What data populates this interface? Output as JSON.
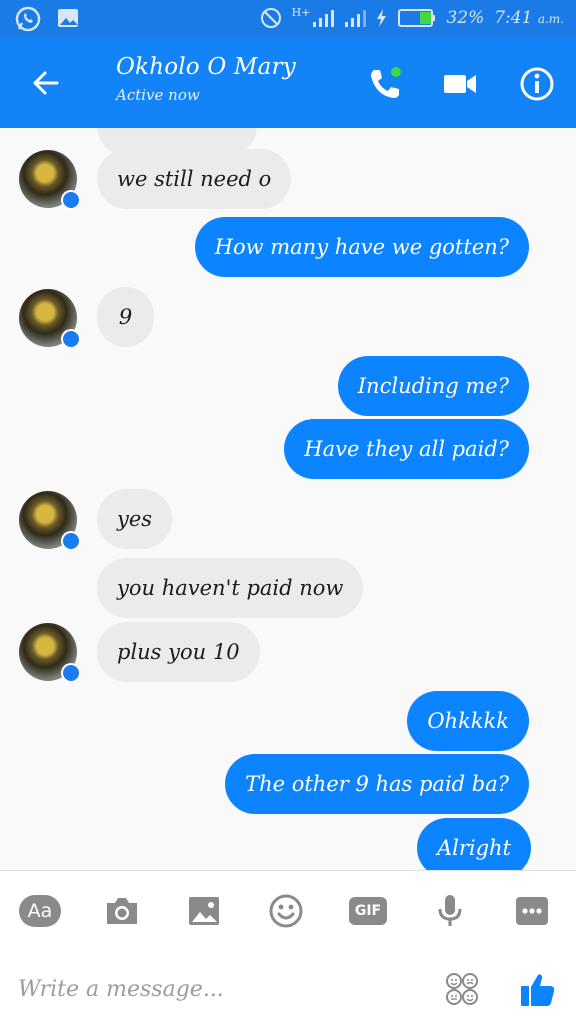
{
  "status_bar": {
    "network": "H+",
    "battery": "32%",
    "time": "7:41",
    "ampm": "a.m."
  },
  "header": {
    "contact_name": "Okholo O Mary",
    "status": "Active now"
  },
  "messages": [
    {
      "from": "them",
      "text": "we still need o"
    },
    {
      "from": "me",
      "text": "How many have we gotten?"
    },
    {
      "from": "them",
      "text": "9"
    },
    {
      "from": "me",
      "text": "Including me?"
    },
    {
      "from": "me",
      "text": "Have they all paid?"
    },
    {
      "from": "them",
      "text": "yes"
    },
    {
      "from": "them",
      "text": "you haven't paid now"
    },
    {
      "from": "them",
      "text": "plus you 10"
    },
    {
      "from": "me",
      "text": "Ohkkkk"
    },
    {
      "from": "me",
      "text": "The other 9 has paid ba?"
    },
    {
      "from": "me",
      "text": "Alright"
    }
  ],
  "composer": {
    "aa_label": "Aa",
    "gif_label": "GIF",
    "placeholder": "Write a message..."
  },
  "colors": {
    "status_bar": "#1a7ae6",
    "header": "#1284f7",
    "outgoing_bubble": "#0c84ff",
    "incoming_bubble": "#ebebeb",
    "online_dot": "#44d744",
    "icon_grey": "#8a8a8a"
  },
  "icons": {
    "status_left": [
      "whatsapp-icon",
      "gallery-icon"
    ],
    "status_right": [
      "do-not-disturb-icon",
      "signal-icon",
      "signal-icon",
      "charging-icon",
      "battery-icon"
    ],
    "header": [
      "back-arrow-icon",
      "phone-icon",
      "video-camera-icon",
      "info-icon"
    ],
    "tools": [
      "aa-icon",
      "camera-icon",
      "image-icon",
      "emoji-icon",
      "gif-icon",
      "microphone-icon",
      "more-icon"
    ],
    "composer": [
      "stickers-icon",
      "thumbs-up-icon"
    ]
  }
}
